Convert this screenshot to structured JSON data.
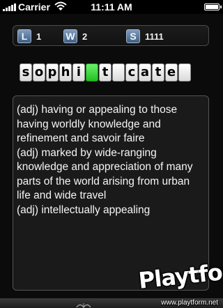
{
  "status_bar": {
    "carrier": "Carrier",
    "time": "11:11 AM",
    "icons": [
      "signal-icon",
      "wifi-icon",
      "battery-icon"
    ]
  },
  "stats": [
    {
      "key": "L",
      "value": "1"
    },
    {
      "key": "W",
      "value": "2"
    },
    {
      "key": "S",
      "value": "1111"
    }
  ],
  "word": {
    "tiles": [
      "s",
      "o",
      "p",
      "h",
      "i",
      "",
      "t",
      "",
      "c",
      "a",
      "t",
      "e",
      ""
    ],
    "active_tile": 5
  },
  "definition": {
    "text": "(adj) having or appealing to those having worldly knowledge and refinement and savoir faire\n(adj) marked by wide-ranging knowledge and appreciation of many parts of the world arising from urban life and wide travel\n(adj) intellectually appealing"
  },
  "watermark": {
    "logo": "Playtform",
    "url": "www.playtform.net"
  },
  "colors": {
    "background": "#0b0b0b",
    "stat_key": "#5a7da3",
    "active_tile": "#3cd83c",
    "definition_panel": "#1a1a1a"
  }
}
